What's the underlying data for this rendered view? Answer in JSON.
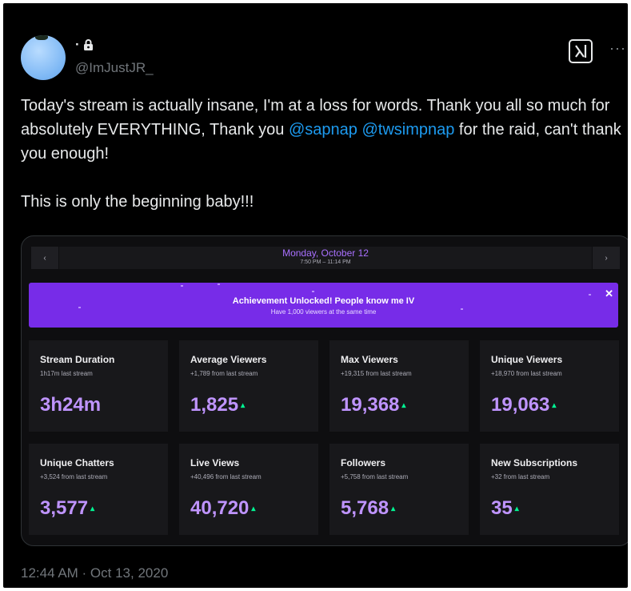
{
  "tweet": {
    "author_name": "·",
    "handle": "@ImJustJR_",
    "text_part1": "Today's stream is actually insane, I'm at a loss for words. Thank you all so much for absolutely EVERYTHING, Thank you ",
    "mention1": "@sapnap",
    "mention2": "@twsimpnap",
    "text_part2": " for the raid, can't thank you enough!",
    "text_line2": "This is only the beginning baby!!!",
    "timestamp": "12:44 AM · Oct 13, 2020",
    "more_label": "···",
    "icons": [
      "lock-icon",
      "grok-icon",
      "more-icon"
    ]
  },
  "dashboard": {
    "date_title": "Monday, October 12",
    "date_range": "7:50 PM – 11:14 PM",
    "prev_label": "‹",
    "next_label": "›",
    "banner_title": "Achievement Unlocked! People know me IV",
    "banner_subtitle": "Have 1,000 viewers at the same time",
    "banner_close": "✕",
    "trend_symbol": "▴",
    "colors": {
      "accent": "#a970ff",
      "banner": "#772ce8",
      "value": "#bf94ff",
      "link": "#1d9bf0"
    },
    "stats": [
      {
        "label": "Stream Duration",
        "sub": "1h17m last stream",
        "value": "3h24m",
        "trend": false
      },
      {
        "label": "Average Viewers",
        "sub": "+1,789 from last stream",
        "value": "1,825",
        "trend": true
      },
      {
        "label": "Max Viewers",
        "sub": "+19,315 from last stream",
        "value": "19,368",
        "trend": true
      },
      {
        "label": "Unique Viewers",
        "sub": "+18,970 from last stream",
        "value": "19,063",
        "trend": true
      },
      {
        "label": "Unique Chatters",
        "sub": "+3,524 from last stream",
        "value": "3,577",
        "trend": true
      },
      {
        "label": "Live Views",
        "sub": "+40,496 from last stream",
        "value": "40,720",
        "trend": true
      },
      {
        "label": "Followers",
        "sub": "+5,758 from last stream",
        "value": "5,768",
        "trend": true
      },
      {
        "label": "New Subscriptions",
        "sub": "+32 from last stream",
        "value": "35",
        "trend": true
      }
    ]
  }
}
